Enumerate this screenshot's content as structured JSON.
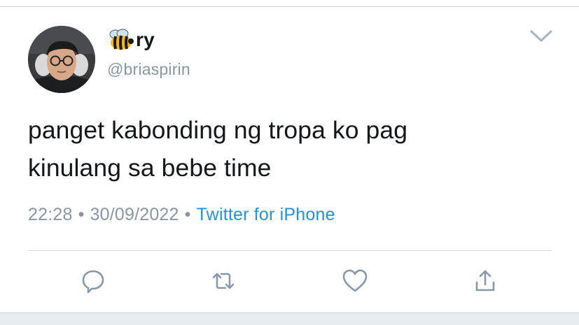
{
  "tweet": {
    "author": {
      "display_name": "ry",
      "emoji": "bee-emoji",
      "handle": "@briaspirin"
    },
    "text_lines": [
      "panget kabonding ng tropa ko pag",
      "kinulang sa bebe time"
    ],
    "meta": {
      "time": "22:28",
      "separator": "•",
      "date": "30/09/2022",
      "source": "Twitter for iPhone"
    },
    "actions": [
      {
        "name": "reply",
        "icon": "reply-icon"
      },
      {
        "name": "retweet",
        "icon": "retweet-icon"
      },
      {
        "name": "like",
        "icon": "heart-icon"
      },
      {
        "name": "share",
        "icon": "share-icon"
      }
    ],
    "menu_icon": "chevron-down-icon"
  },
  "colors": {
    "text": "#14171a",
    "secondary_text": "#8a96a3",
    "link": "#1b95e0",
    "icon": "#8899a6",
    "divider": "#d6dbe0",
    "background": "#ffffff",
    "bottom_band": "#e6ecf0"
  }
}
